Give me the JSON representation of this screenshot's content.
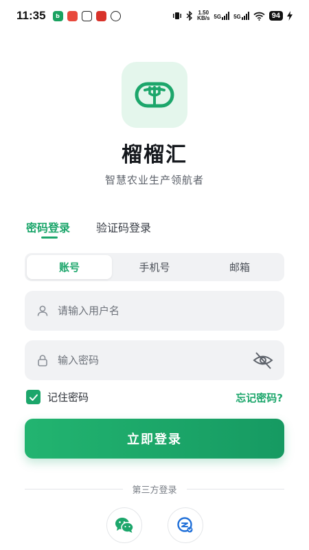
{
  "status_bar": {
    "time": "11:35",
    "net_speed_value": "1.50",
    "net_speed_unit": "KB/s",
    "signal_1": "5G",
    "signal_2": "5G",
    "battery": "94"
  },
  "app": {
    "name": "榴榴汇",
    "slogan": "智慧农业生产领航者"
  },
  "login_tabs": [
    {
      "label": "密码登录",
      "active": true
    },
    {
      "label": "验证码登录",
      "active": false
    }
  ],
  "account_types": [
    {
      "label": "账号",
      "active": true
    },
    {
      "label": "手机号",
      "active": false
    },
    {
      "label": "邮箱",
      "active": false
    }
  ],
  "form": {
    "username_placeholder": "请输入用户名",
    "username_value": "",
    "password_placeholder": "输入密码",
    "password_value": "",
    "remember_label": "记住密码",
    "remember_checked": true,
    "forgot_label": "忘记密码?",
    "submit_label": "立即登录"
  },
  "third_party": {
    "label": "第三方登录",
    "providers": [
      "wechat-icon",
      "qq-icon"
    ]
  },
  "colors": {
    "accent": "#1ca66b",
    "logo_bg": "#e4f6ec",
    "field_bg": "#f1f2f4"
  }
}
